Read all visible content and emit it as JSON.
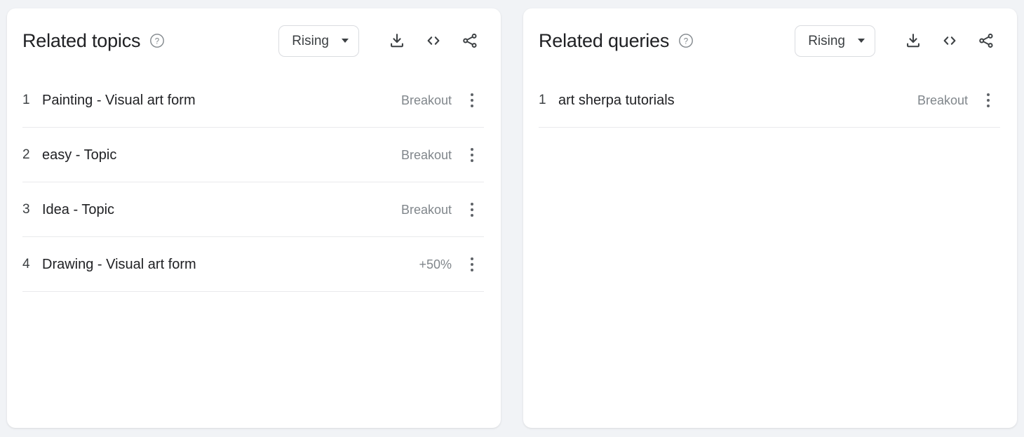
{
  "page": {
    "background_color": "#f1f3f6",
    "card_background": "#ffffff"
  },
  "panels": [
    {
      "id": "related-topics",
      "title": "Related topics",
      "help_icon": "help-circle-icon",
      "filter": {
        "value": "Rising",
        "caret_icon": "chevron-down-icon"
      },
      "actions": [
        {
          "name": "download-icon",
          "label": "download"
        },
        {
          "name": "embed-code-icon",
          "label": "embed"
        },
        {
          "name": "share-icon",
          "label": "share"
        }
      ],
      "rows": [
        {
          "rank": "1",
          "label": "Painting - Visual art form",
          "value": "Breakout",
          "menu_icon": "more-vert-icon"
        },
        {
          "rank": "2",
          "label": "easy - Topic",
          "value": "Breakout",
          "menu_icon": "more-vert-icon"
        },
        {
          "rank": "3",
          "label": "Idea - Topic",
          "value": "Breakout",
          "menu_icon": "more-vert-icon"
        },
        {
          "rank": "4",
          "label": "Drawing - Visual art form",
          "value": "+50%",
          "menu_icon": "more-vert-icon"
        }
      ]
    },
    {
      "id": "related-queries",
      "title": "Related queries",
      "help_icon": "help-circle-icon",
      "filter": {
        "value": "Rising",
        "caret_icon": "chevron-down-icon"
      },
      "actions": [
        {
          "name": "download-icon",
          "label": "download"
        },
        {
          "name": "embed-code-icon",
          "label": "embed"
        },
        {
          "name": "share-icon",
          "label": "share"
        }
      ],
      "rows": [
        {
          "rank": "1",
          "label": "art sherpa tutorials",
          "value": "Breakout",
          "menu_icon": "more-vert-icon"
        }
      ]
    }
  ]
}
